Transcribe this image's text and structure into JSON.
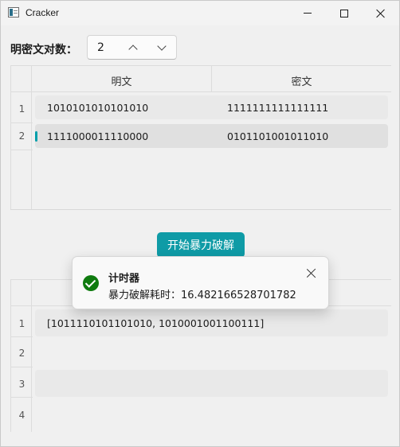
{
  "window": {
    "title": "Cracker",
    "icons": {
      "app": "app-window-icon",
      "minimize": "minimize-icon",
      "maximize": "maximize-icon",
      "close": "close-icon"
    }
  },
  "controls": {
    "pairs_label": "明密文对数：",
    "pairs_value": "2",
    "increment_icon": "chevron-up-icon",
    "decrement_icon": "chevron-down-icon"
  },
  "input_table": {
    "headers": [
      "明文",
      "密文"
    ],
    "rows": [
      {
        "num": "1",
        "plaintext": "1010101010101010",
        "ciphertext": "1111111111111111"
      },
      {
        "num": "2",
        "plaintext": "1111000011110000",
        "ciphertext": "0101101001011010"
      }
    ],
    "selected_row": 2,
    "accent_color": "#009faa"
  },
  "action": {
    "start_label": "开始暴力破解",
    "color": "#0f9ba6"
  },
  "result_table": {
    "rows": [
      {
        "num": "1",
        "value": "[1011110101101010, 1010001001100111]"
      },
      {
        "num": "2",
        "value": ""
      },
      {
        "num": "3",
        "value": ""
      },
      {
        "num": "4",
        "value": ""
      }
    ]
  },
  "toast": {
    "title": "计时器",
    "message": "暴力破解耗时：16.482166528701782",
    "status_icon": "success-check-icon",
    "status_color": "#0f7b0f",
    "close_icon": "close-icon"
  }
}
